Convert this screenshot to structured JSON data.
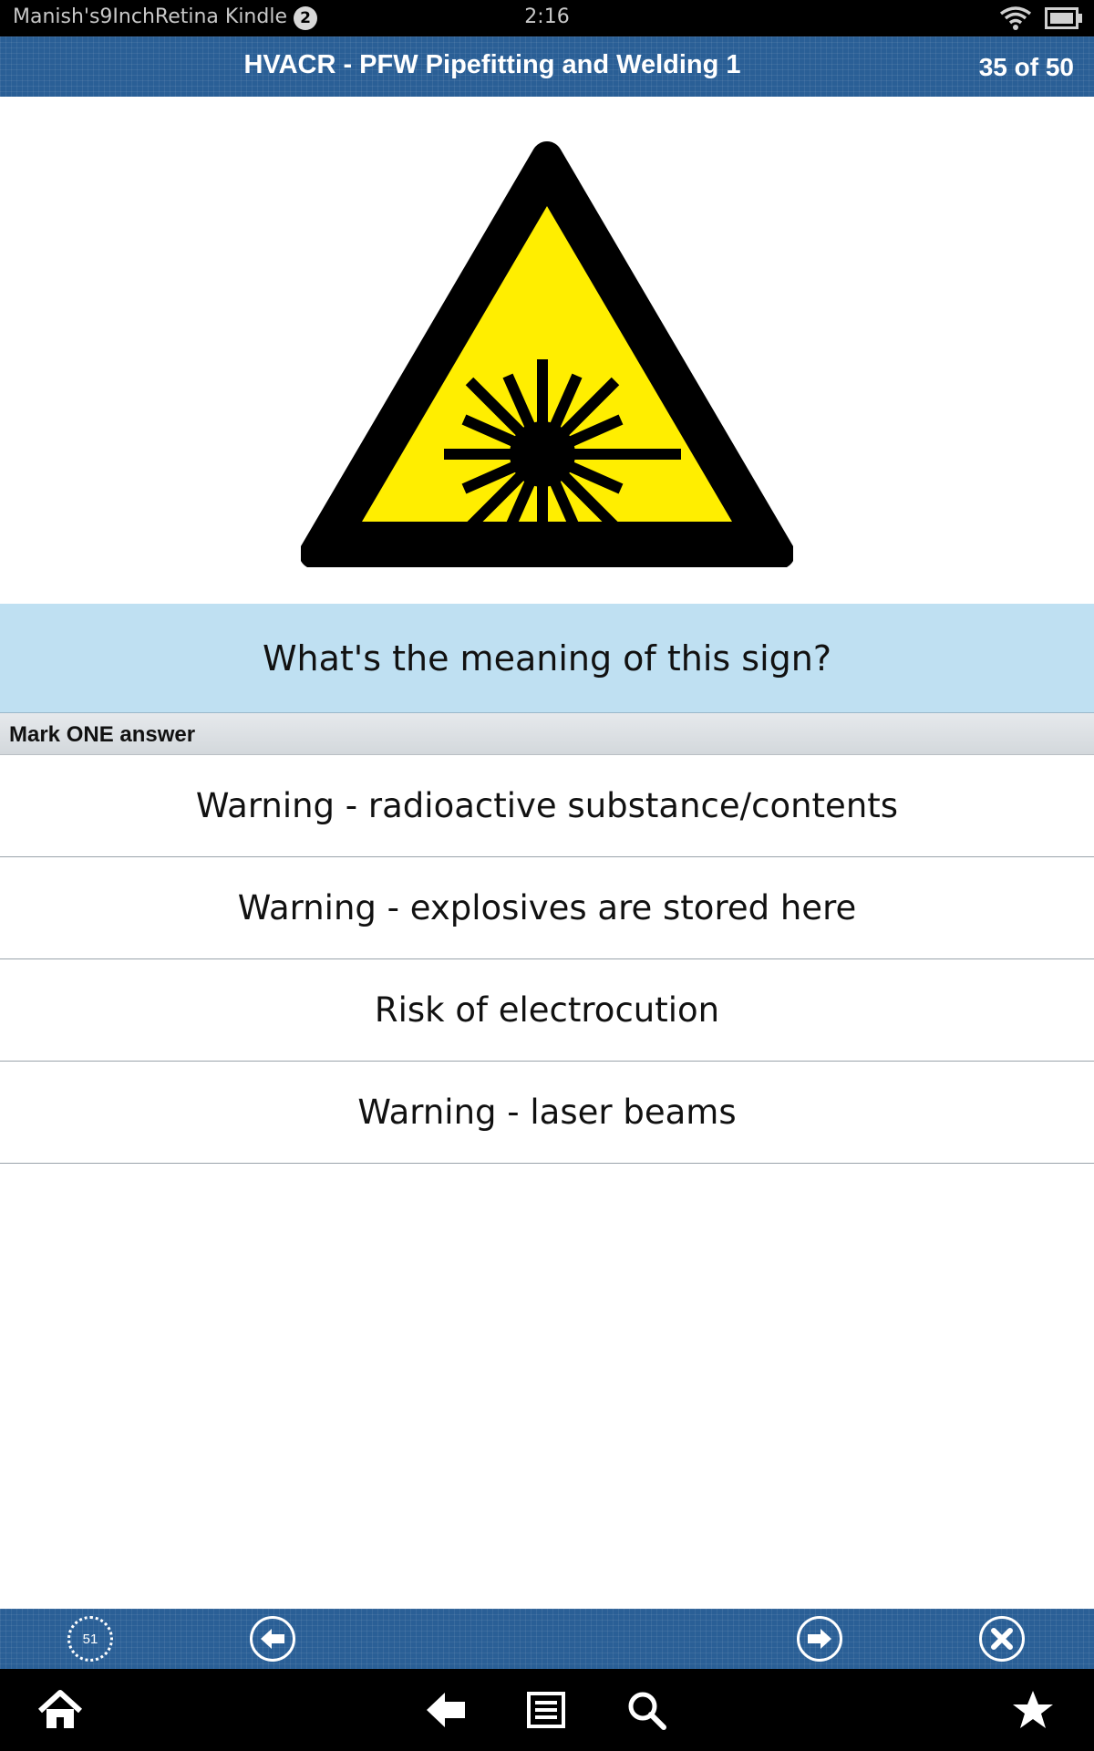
{
  "status_bar": {
    "device_name": "Manish's9InchRetina Kindle",
    "notification_count": "2",
    "time": "2:16"
  },
  "header": {
    "title": "HVACR - PFW Pipefitting and Welding 1",
    "counter": "35 of 50"
  },
  "sign": {
    "icon": "laser-warning-sign",
    "colors": {
      "fill": "#ffee00",
      "border": "#000000"
    }
  },
  "question": {
    "text": "What's the meaning of this sign?"
  },
  "instruction": "Mark ONE answer",
  "answers": [
    "Warning - radioactive substance/contents",
    "Warning - explosives are stored here",
    "Risk of electrocution",
    "Warning - laser beams"
  ],
  "toolbar": {
    "timer_value": "51",
    "buttons": [
      "timer-icon",
      "arrow-left-circle-icon",
      "arrow-right-circle-icon",
      "close-circle-icon"
    ]
  },
  "nav_bar": {
    "icons": [
      "home-icon",
      "back-arrow-icon",
      "menu-icon",
      "search-icon",
      "star-icon"
    ]
  },
  "colors": {
    "header_bg": "#2a5f96",
    "question_bg": "#bfe0f2"
  }
}
